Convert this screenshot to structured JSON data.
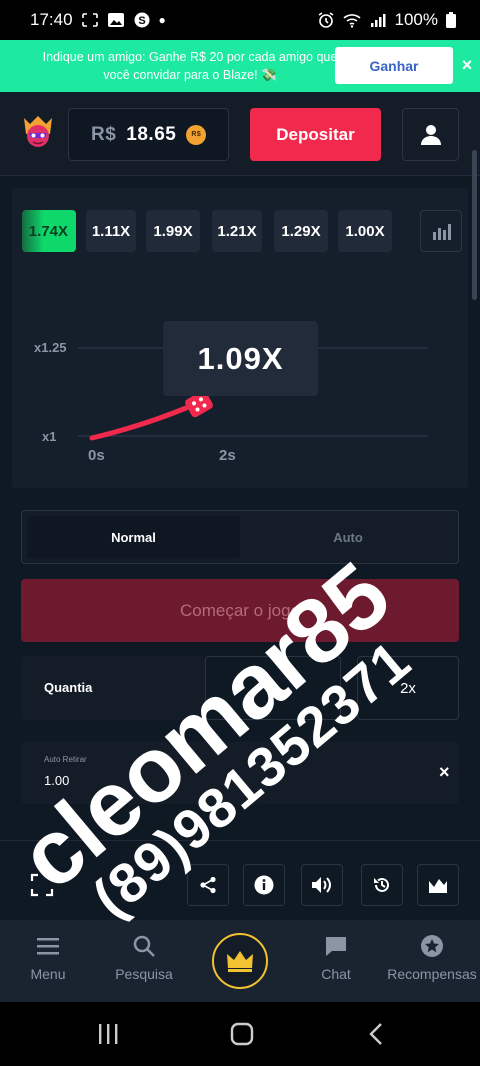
{
  "status_bar": {
    "time": "17:40",
    "battery": "100%"
  },
  "promo": {
    "text": "Indique um amigo: Ganhe R$ 20 por cada amigo que você convidar para o Blaze! 💸",
    "button_label": "Ganhar",
    "close_label": "×"
  },
  "header": {
    "currency": "R$",
    "balance": "18.65",
    "coin_label": "R$",
    "deposit_label": "Depositar"
  },
  "history": [
    "1.74X",
    "1.11X",
    "1.99X",
    "1.21X",
    "1.29X",
    "1.00X"
  ],
  "game": {
    "multiplier": "1.09X",
    "y_labels": [
      "x1.25",
      "x1"
    ],
    "x_labels": [
      "0s",
      "2s"
    ]
  },
  "modes": {
    "active": "Normal",
    "other": "Auto"
  },
  "start_button": "Começar o jogo",
  "bet": {
    "amount_label": "Quantia",
    "half_label": "½",
    "double_label": "2x"
  },
  "auto_retire": {
    "label": "Auto Retirar",
    "value": "1.00",
    "clear_label": "×"
  },
  "bottom_nav": [
    {
      "label": "Menu",
      "icon": "menu-icon"
    },
    {
      "label": "Pesquisa",
      "icon": "search-icon"
    },
    {
      "label": "",
      "icon": "crown-icon"
    },
    {
      "label": "Chat",
      "icon": "chat-icon"
    },
    {
      "label": "Recompensas",
      "icon": "star-icon"
    }
  ],
  "watermark": {
    "line1": "cleomar85",
    "line2": "(89)981352371"
  },
  "colors": {
    "accent_red": "#f0294d",
    "promo_green": "#1de9a0",
    "win_green": "#0fd86a",
    "crown_gold": "#f2c230",
    "background": "#0f1923"
  }
}
